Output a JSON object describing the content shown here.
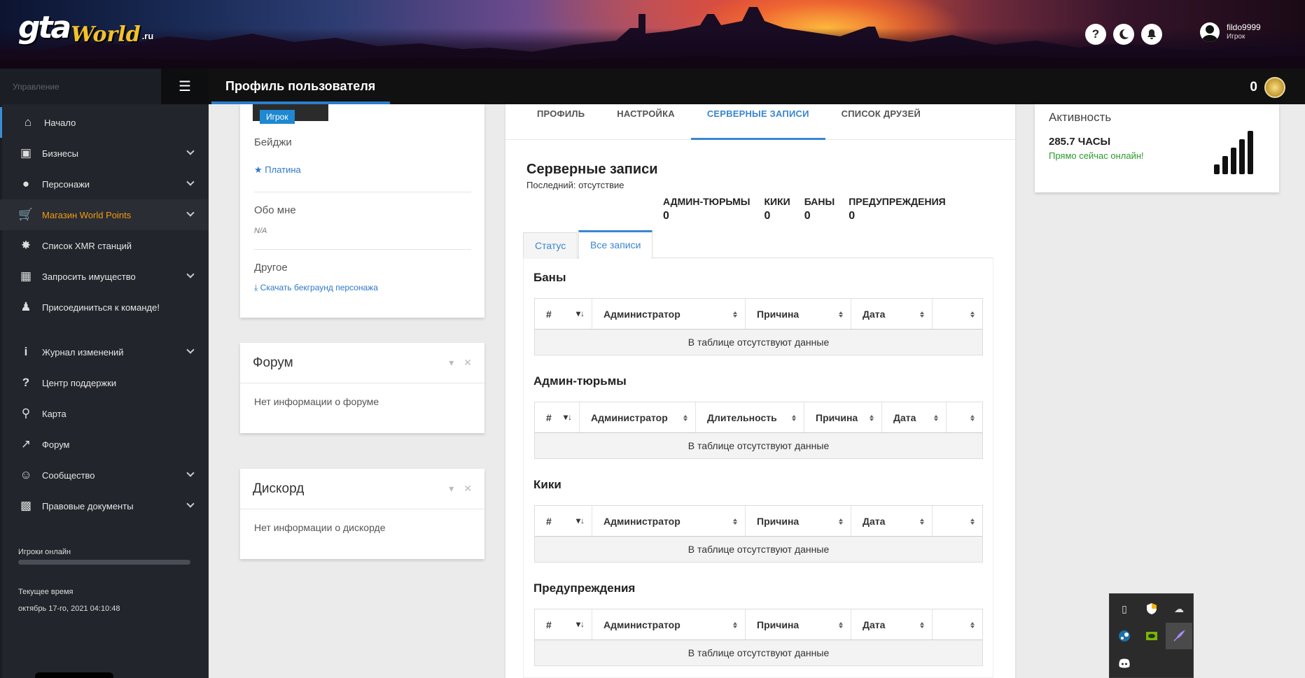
{
  "header": {
    "logo": {
      "gta": "gta",
      "world": "World",
      "ru": ".ru"
    },
    "icons": [
      "help-icon",
      "moon-icon",
      "bell-icon"
    ],
    "user": {
      "name": "fildo9999",
      "role": "Игрок"
    }
  },
  "topbar": {
    "menu_label": "Управление",
    "title": "Профиль пользователя",
    "points": "0"
  },
  "sidebar": {
    "items": [
      {
        "label": "Начало",
        "icon": "home-icon"
      },
      {
        "label": "Бизнесы",
        "icon": "briefcase-icon"
      },
      {
        "label": "Персонажи",
        "icon": "user-icon"
      },
      {
        "label": "Магазин World Points",
        "icon": "cart-icon"
      },
      {
        "label": "Список XMR станций",
        "icon": "antenna-icon"
      },
      {
        "label": "Запросить имущество",
        "icon": "building-icon"
      },
      {
        "label": "Присоединиться к команде!",
        "icon": "user-tie-icon"
      },
      {
        "label": "Журнал изменений",
        "icon": "info-icon"
      },
      {
        "label": "Центр поддержки",
        "icon": "question-icon"
      },
      {
        "label": "Карта",
        "icon": "map-marker-icon"
      },
      {
        "label": "Форум",
        "icon": "external-link-icon"
      },
      {
        "label": "Сообщество",
        "icon": "discord-icon"
      },
      {
        "label": "Правовые документы",
        "icon": "lock-icon"
      }
    ],
    "online_label": "Игроки онлайн",
    "time_label": "Текущее время",
    "time_value": "октябрь 17-го, 2021 04:10:48"
  },
  "profile_card": {
    "role_badge": "Игрок",
    "badges_label": "Бейджи",
    "badge_value": "Платина",
    "about_label": "Обо мне",
    "about_value": "N/A",
    "other_label": "Другое",
    "download_link": "Скачать бекграунд персонажа"
  },
  "forum_card": {
    "title": "Форум",
    "body": "Нет информации о форуме"
  },
  "discord_card": {
    "title": "Дискорд",
    "body": "Нет информации о дискорде"
  },
  "main": {
    "tabs": [
      "ПРОФИЛЬ",
      "НАСТРОЙКА",
      "СЕРВЕРНЫЕ ЗАПИСИ",
      "СПИСОК ДРУЗЕЙ"
    ],
    "section_title": "Серверные записи",
    "section_sub": "Последний: отсутствие",
    "stats": [
      {
        "label": "АДМИН-ТЮРЬМЫ",
        "value": "0"
      },
      {
        "label": "КИКИ",
        "value": "0"
      },
      {
        "label": "БАНЫ",
        "value": "0"
      },
      {
        "label": "ПРЕДУПРЕЖДЕНИЯ",
        "value": "0"
      }
    ],
    "subtabs": [
      "Статус",
      "Все записи"
    ],
    "empty_text": "В таблице отсутствуют данные",
    "tables": [
      {
        "title": "Баны",
        "columns": [
          "#",
          "Администратор",
          "Причина",
          "Дата",
          ""
        ]
      },
      {
        "title": "Админ-тюрьмы",
        "columns": [
          "#",
          "Администратор",
          "Длительность",
          "Причина",
          "Дата",
          ""
        ]
      },
      {
        "title": "Кики",
        "columns": [
          "#",
          "Администратор",
          "Причина",
          "Дата",
          ""
        ]
      },
      {
        "title": "Предупреждения",
        "columns": [
          "#",
          "Администратор",
          "Причина",
          "Дата",
          ""
        ]
      }
    ]
  },
  "activity": {
    "title": "Активность",
    "hours": "285.7 ЧАСЫ",
    "online": "Прямо сейчас онлайн!"
  },
  "tray": {
    "icons": [
      "usb-icon",
      "shield-icon",
      "cloud-off-icon",
      "steam-icon",
      "nvidia-icon",
      "feather-icon",
      "discord-tray-icon"
    ]
  }
}
